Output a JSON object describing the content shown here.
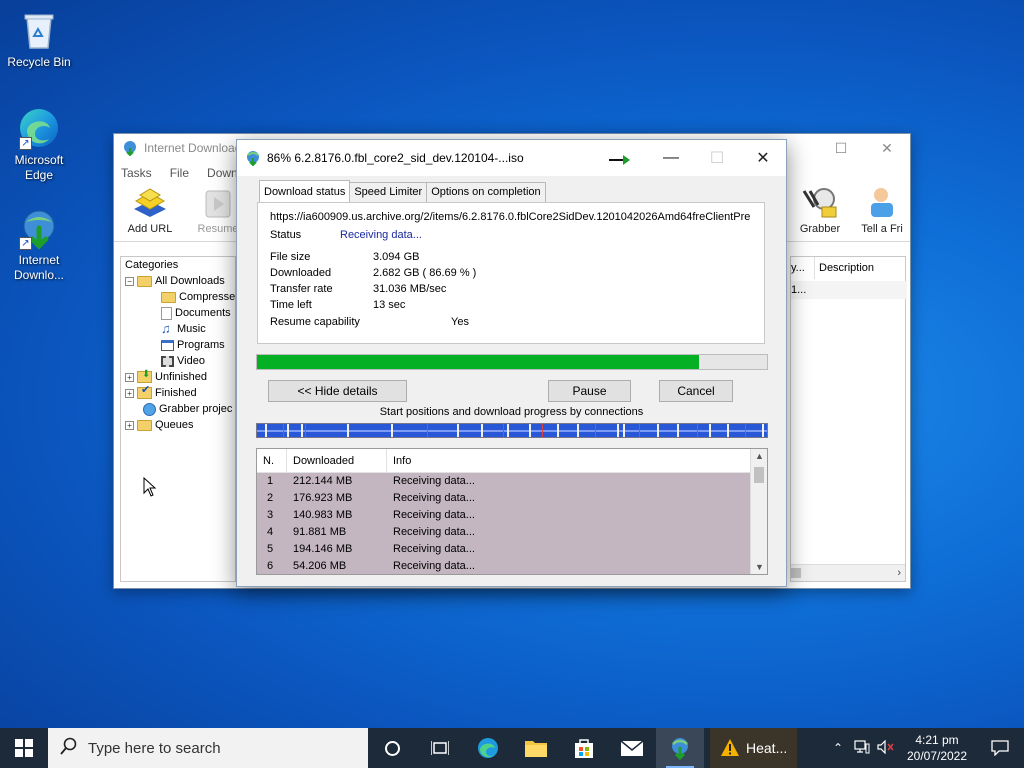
{
  "desktop": {
    "icons": [
      {
        "label": "Recycle Bin"
      },
      {
        "label": "Microsoft Edge"
      },
      {
        "label": "Internet Downlo..."
      }
    ]
  },
  "idm_main": {
    "title": "Internet Download",
    "menu": [
      "Tasks",
      "File",
      "Downlo"
    ],
    "toolbar": {
      "add_url": "Add URL",
      "resume": "Resume",
      "grabber": "Grabber",
      "tell_friend": "Tell a Fri"
    },
    "categories": {
      "header": "Categories",
      "items": [
        "All Downloads",
        "Compresse",
        "Documents",
        "Music",
        "Programs",
        "Video",
        "Unfinished",
        "Finished",
        "Grabber projec",
        "Queues"
      ]
    },
    "list": {
      "col_partial": "y...",
      "description": "Description",
      "row_partial": "1..."
    }
  },
  "dialog": {
    "title": "86% 6.2.8176.0.fbl_core2_sid_dev.120104-...iso",
    "tabs": [
      "Download status",
      "Speed Limiter",
      "Options on completion"
    ],
    "url": "https://ia600909.us.archive.org/2/items/6.2.8176.0.fblCore2SidDev.1201042026Amd64freClientPre",
    "status": {
      "label": "Status",
      "value": "Receiving data..."
    },
    "file_size": {
      "label": "File size",
      "value": "3.094  GB"
    },
    "downloaded": {
      "label": "Downloaded",
      "value": "2.682  GB  ( 86.69 % )"
    },
    "transfer_rate": {
      "label": "Transfer rate",
      "value": "31.036  MB/sec"
    },
    "time_left": {
      "label": "Time left",
      "value": "13 sec"
    },
    "resume_capability": {
      "label": "Resume capability",
      "value": "Yes"
    },
    "progress": 0.8669,
    "buttons": {
      "hide_details": "<< Hide details",
      "pause": "Pause",
      "cancel": "Cancel"
    },
    "connections_label": "Start positions and download progress by connections",
    "table": {
      "headers": [
        "N.",
        "Downloaded",
        "Info"
      ],
      "rows": [
        {
          "n": "1",
          "downloaded": "212.144  MB",
          "info": "Receiving data..."
        },
        {
          "n": "2",
          "downloaded": "176.923  MB",
          "info": "Receiving data..."
        },
        {
          "n": "3",
          "downloaded": "140.983  MB",
          "info": "Receiving data..."
        },
        {
          "n": "4",
          "downloaded": "91.881  MB",
          "info": "Receiving data..."
        },
        {
          "n": "5",
          "downloaded": "194.146  MB",
          "info": "Receiving data..."
        },
        {
          "n": "6",
          "downloaded": "54.206  MB",
          "info": "Receiving data..."
        }
      ]
    }
  },
  "taskbar": {
    "search_placeholder": "Type here to search",
    "weather": "Heat...",
    "time": "4:21 pm",
    "date": "20/07/2022"
  },
  "colors": {
    "progress_fill": "#06b025",
    "connection_bar": "#2858d8",
    "selected_rows": "#c4b6c1",
    "taskbar": "#1d2a3a"
  }
}
